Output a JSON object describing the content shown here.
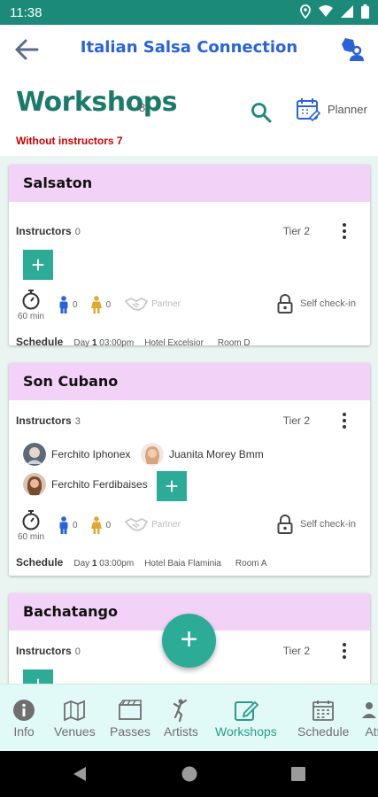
{
  "status": {
    "time": "11:38"
  },
  "appbar": {
    "title": "Italian Salsa Connection"
  },
  "header": {
    "title": "Workshops",
    "count": "8",
    "without_instructors": "Without instructors 7",
    "planner_label": "Planner"
  },
  "workshops": [
    {
      "name": "Salsaton",
      "instructors_label": "Instructors",
      "instructors_count": "0",
      "tier": "Tier 2",
      "duration": "60 min",
      "male_count": "0",
      "female_count": "0",
      "partner_label": "Partner",
      "checkin_label": "Self check-in",
      "schedule_label": "Schedule",
      "day_prefix": "Day",
      "day_num": "1",
      "time": "03:00pm",
      "hotel": "Hotel Excelsior",
      "room": "Room D"
    },
    {
      "name": "Son Cubano",
      "instructors_label": "Instructors",
      "instructors_count": "3",
      "tier": "Tier 2",
      "instructors": [
        "Ferchito Iphonex",
        "Juanita Morey Bmm",
        "Ferchito Ferdibaises"
      ],
      "duration": "60 min",
      "male_count": "0",
      "female_count": "0",
      "partner_label": "Partner",
      "checkin_label": "Self check-in",
      "schedule_label": "Schedule",
      "day_prefix": "Day",
      "day_num": "1",
      "time": "03:00pm",
      "hotel": "Hotel Baia Flaminia",
      "room": "Room A"
    },
    {
      "name": "Bachatango",
      "instructors_label": "Instructors",
      "instructors_count": "0",
      "tier": "Tier 2"
    }
  ],
  "fab_label": "+",
  "add_label": "+",
  "nav": [
    {
      "label": "Info",
      "icon": "info-icon"
    },
    {
      "label": "Venues",
      "icon": "map-icon"
    },
    {
      "label": "Passes",
      "icon": "ticket-icon"
    },
    {
      "label": "Artists",
      "icon": "dancer-icon"
    },
    {
      "label": "Workshops",
      "icon": "edit-icon",
      "active": true
    },
    {
      "label": "Schedule",
      "icon": "calendar-icon"
    },
    {
      "label": "Att",
      "icon": "people-icon"
    }
  ],
  "colors": {
    "primary": "#1c8a78",
    "accent": "#2cab97",
    "title_blue": "#2a63d8",
    "card_header": "#f3d2f7",
    "alert_red": "#cc0000"
  }
}
